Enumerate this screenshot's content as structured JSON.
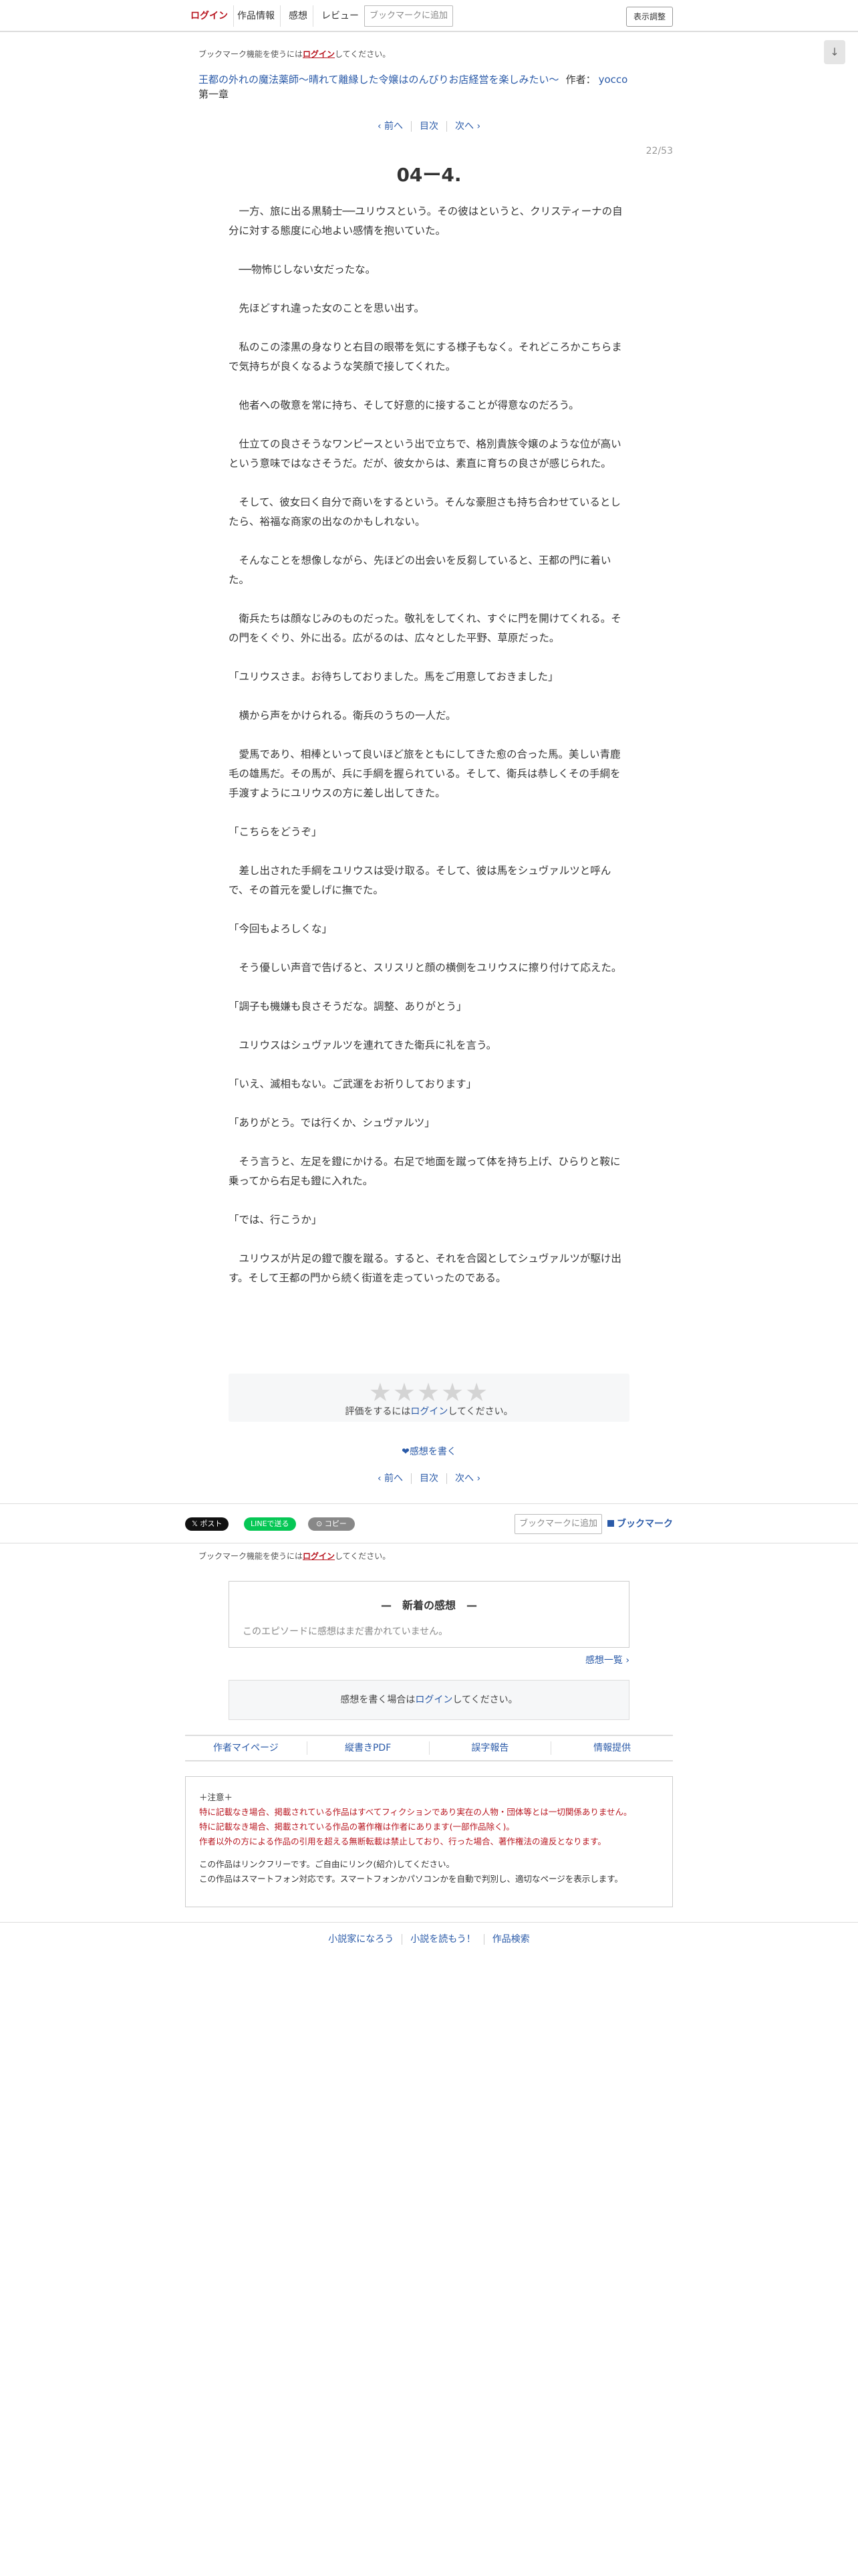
{
  "topbar": {
    "login": "ログイン",
    "work_info": "作品情報",
    "impressions": "感想",
    "review": "レビュー",
    "bookmark_add": "ブックマークに追加",
    "display_settings": "表示調整"
  },
  "scroll_button": "↓",
  "bookmark_notice": {
    "prefix": "ブックマーク機能を使うには",
    "login": "ログイン",
    "suffix": "してください。"
  },
  "series": {
    "title": "王都の外れの魔法薬師〜晴れて離縁した令嬢はのんびりお店経営を楽しみたい〜",
    "author_label": "作者：",
    "author": "yocco",
    "chapter": "第一章"
  },
  "pager": {
    "prev": "‹ 前へ",
    "toc": "目次",
    "next": "次へ ›"
  },
  "page_number": "22/53",
  "episode_title": "04ー4.",
  "honbun": [
    "　一方、旅に出る黒騎士──ユリウスという。その彼はというと、クリスティーナの自分に対する態度に心地よい感情を抱いていた。",
    "　──物怖じしない女だったな。",
    "　先ほどすれ違った女のことを思い出す。",
    "　私のこの漆黒の身なりと右目の眼帯を気にする様子もなく。それどころかこちらまで気持ちが良くなるような笑顔で接してくれた。",
    "　他者への敬意を常に持ち、そして好意的に接することが得意なのだろう。",
    "　仕立ての良さそうなワンピースという出で立ちで、格別貴族令嬢のような位が高いという意味ではなさそうだ。だが、彼女からは、素直に育ちの良さが感じられた。",
    "　そして、彼女曰く自分で商いをするという。そんな豪胆さも持ち合わせているとしたら、裕福な商家の出なのかもしれない。",
    "　そんなことを想像しながら、先ほどの出会いを反芻していると、王都の門に着いた。",
    "　衛兵たちは顔なじみのものだった。敬礼をしてくれ、すぐに門を開けてくれる。その門をくぐり、外に出る。広がるのは、広々とした平野、草原だった。",
    "「ユリウスさま。お待ちしておりました。馬をご用意しておきました」",
    "　横から声をかけられる。衛兵のうちの一人だ。",
    "　愛馬であり、相棒といって良いほど旅をともにしてきた愈の合った馬。美しい青鹿毛の雄馬だ。その馬が、兵に手綱を握られている。そして、衛兵は恭しくその手綱を手渡すようにユリウスの方に差し出してきた。",
    "「こちらをどうぞ」",
    "　差し出された手綱をユリウスは受け取る。そして、彼は馬をシュヴァルツと呼んで、その首元を愛しげに撫でた。",
    "「今回もよろしくな」",
    "　そう優しい声音で告げると、スリスリと顔の横側をユリウスに擦り付けて応えた。",
    "「調子も機嫌も良さそうだな。調整、ありがとう」",
    "　ユリウスはシュヴァルツを連れてきた衛兵に礼を言う。",
    "「いえ、滅相もない。ご武運をお祈りしております」",
    "「ありがとう。では行くか、シュヴァルツ」",
    "　そう言うと、左足を鐙にかける。右足で地面を蹴って体を持ち上げ、ひらりと鞍に乗ってから右足も鐙に入れた。",
    "「では、行こうか」",
    "　ユリウスが片足の鐙で腹を蹴る。すると、それを合図としてシュヴァルツが駆け出す。そして王都の門から続く街道を走っていったのである。"
  ],
  "rating": {
    "stars": "★★★★★",
    "prefix": "評価をするには",
    "login": "ログイン",
    "suffix": "してください。"
  },
  "write_impression": "❤感想を書く",
  "share": {
    "x_post": "𝕏 ポスト",
    "line": "LINEで送る",
    "copy": "⊙ コピー",
    "bookmark_add": "ブックマークに追加",
    "bookmark": "ブックマーク"
  },
  "impressions_box": {
    "heading": "—　新着の感想　—",
    "empty": "このエピソードに感想はまだ書かれていません。",
    "list_link": "感想一覧 ›",
    "login_prefix": "感想を書く場合は",
    "login": "ログイン",
    "login_suffix": "してください。"
  },
  "footer_links": [
    "作者マイページ",
    "縦書きPDF",
    "誤字報告",
    "情報提供"
  ],
  "notices": {
    "heading": "＋注意＋",
    "red1": "特に記載なき場合、掲載されている作品はすべてフィクションであり実在の人物・団体等とは一切関係ありません。",
    "red2": "特に記載なき場合、掲載されている作品の著作権は作者にあります(一部作品除く)。",
    "red3": "作者以外の方による作品の引用を超える無断転載は禁止しており、行った場合、著作権法の違反となります。",
    "line1": "この作品はリンクフリーです。ご自由にリンク(紹介)してください。",
    "line2": "この作品はスマートフォン対応です。スマートフォンかパソコンかを自動で判別し、適切なページを表示します。"
  },
  "bottom_links": [
    "小説家になろう",
    "小説を読もう！",
    "作品検索"
  ]
}
